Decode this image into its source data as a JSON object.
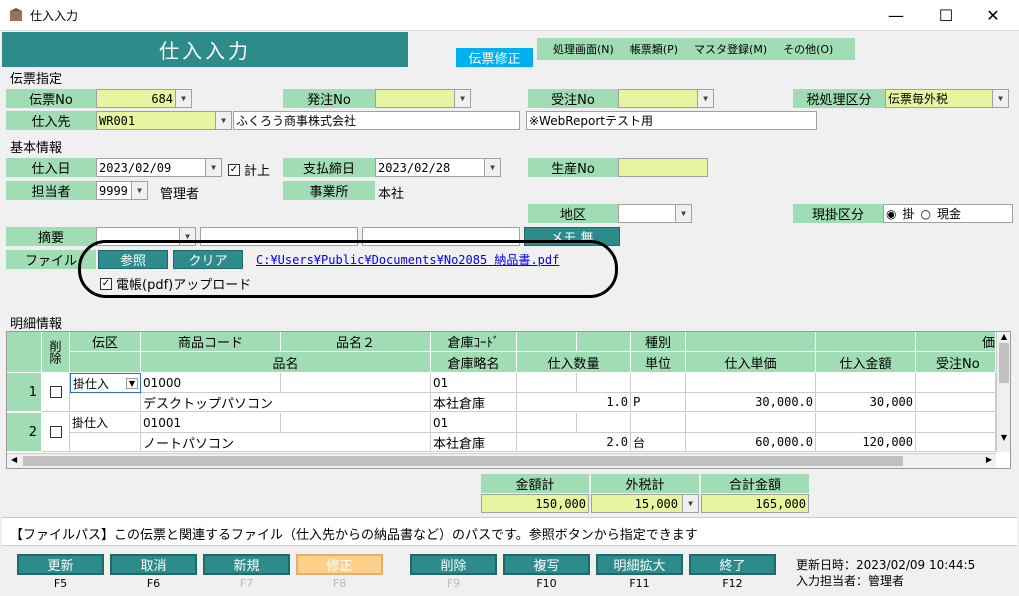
{
  "window": {
    "title": "仕入入力",
    "minimize": "—",
    "maximize": "☐",
    "close": "✕"
  },
  "header": {
    "title": "仕入入力",
    "mode": "伝票修正",
    "menu": [
      "処理画面(N)",
      "帳票類(P)",
      "マスタ登録(M)",
      "その他(O)"
    ]
  },
  "slip": {
    "section": "伝票指定",
    "slip_no_label": "伝票No",
    "slip_no": "684",
    "order_no_label": "発注No",
    "order_no": "",
    "received_no_label": "受注No",
    "received_no": "",
    "tax_label": "税処理区分",
    "tax_value": "伝票毎外税",
    "supplier_label": "仕入先",
    "supplier_code": "WR001",
    "supplier_name": "ふくろう商事株式会社",
    "note_field": "※WebReportテスト用"
  },
  "basic": {
    "section": "基本情報",
    "date_label": "仕入日",
    "date": "2023/02/09",
    "keijo_label": "計上",
    "pay_label": "支払締日",
    "pay_date": "2023/02/28",
    "prod_label": "生産No",
    "prod_no": "",
    "staff_label": "担当者",
    "staff_code": "9999",
    "staff_name": "管理者",
    "office_label": "事業所",
    "office": "本社",
    "area_label": "地区",
    "area": "",
    "cash_label": "現掛区分",
    "cash_opt1": "掛",
    "cash_opt2": "現金",
    "memo_label": "摘要",
    "memo_btn": "メモ 無",
    "file_label": "ファイル",
    "browse_btn": "参照",
    "clear_btn": "クリア",
    "file_path": "C:¥Users¥Public¥Documents¥No2085 納品書.pdf",
    "upload_label": "電帳(pdf)アップロード"
  },
  "detail": {
    "section": "明細情報",
    "headers_top": [
      "削除",
      "伝区",
      "商品コード",
      "品名２",
      "倉庫ｺｰﾄﾞ",
      "",
      "",
      "種別",
      "",
      "",
      "価"
    ],
    "headers_bottom": [
      "品名",
      "倉庫略名",
      "仕入数量",
      "単位",
      "仕入単価",
      "仕入金額",
      "受注No"
    ],
    "rows": [
      {
        "no": "1",
        "kubun": "掛仕入",
        "code": "01000",
        "wh_code": "01",
        "name": "デスクトップパソコン",
        "wh_name": "本社倉庫",
        "qty": "1.0",
        "unit": "P",
        "price": "30,000.0",
        "amount": "30,000"
      },
      {
        "no": "2",
        "kubun": "掛仕入",
        "code": "01001",
        "wh_code": "01",
        "name": "ノートパソコン",
        "wh_name": "本社倉庫",
        "qty": "2.0",
        "unit": "台",
        "price": "60,000.0",
        "amount": "120,000"
      }
    ]
  },
  "totals": {
    "sum_label": "金額計",
    "sum": "150,000",
    "tax_label": "外税計",
    "tax": "15,000",
    "total_label": "合計金額",
    "total": "165,000"
  },
  "status": {
    "message": "【ファイルパス】この伝票と関連するファイル（仕入先からの納品書など）のパスです。参照ボタンから指定できます"
  },
  "fkeys": [
    {
      "label": "更新",
      "key": "F5"
    },
    {
      "label": "取消",
      "key": "F6"
    },
    {
      "label": "新規",
      "key": "F7"
    },
    {
      "label": "修正",
      "key": "F8"
    },
    {
      "label": "削除",
      "key": "F9"
    },
    {
      "label": "複写",
      "key": "F10"
    },
    {
      "label": "明細拡大",
      "key": "F11"
    },
    {
      "label": "終了",
      "key": "F12"
    }
  ],
  "footer": {
    "updated": "更新日時：2023/02/09 10:44:5",
    "operator": "入力担当者：管理者"
  },
  "colors": {
    "teal": "#2e8b8b",
    "green": "#a0dcb4",
    "yellow": "#e6f5a0",
    "blue": "#00b0f0",
    "orange": "#ffd08a"
  }
}
